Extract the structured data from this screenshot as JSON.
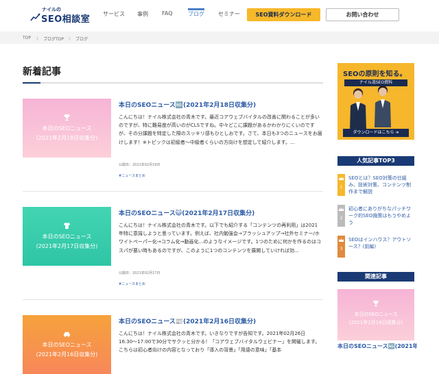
{
  "header": {
    "logo_small": "ナイルの",
    "logo_main": "SEO相談室",
    "nav": [
      {
        "label": "サービス"
      },
      {
        "label": "事例"
      },
      {
        "label": "FAQ"
      },
      {
        "label": "ブログ"
      },
      {
        "label": "セミナー"
      }
    ],
    "download_label": "SEO資料ダウンロード",
    "contact_label": "お問い合わせ"
  },
  "breadcrumb": [
    "TOP",
    "ブログTOP",
    "ブログ"
  ],
  "breadcrumb_sep": "〉",
  "main": {
    "section_title": "新着記事",
    "articles": [
      {
        "thumb_lines": [
          "本日のSEOニュース",
          "(2021年2月18日収集分)"
        ],
        "title": "本日のSEOニュース🆖(2021年2月18日収集分)",
        "body": "こんにちは！ナイル株式会社の青木です。最近コアウェブバイタルの改善に関わることが多いのですが、特に難易度が高いのがCLSですね。中々どこに課題があるかわかりにくいのですが、その分課題を特定した際のスッキリ感もひとしおです。さて、本日も3つのニュースをお届けします！※トピックは初級者〜中級者くらいの方向けを想定して紹介します。...",
        "date": "公開日：2021年02月19日",
        "tag": "#ニュースまとめ"
      },
      {
        "thumb_lines": [
          "本日のSEOニュース",
          "(2021年2月17日収集分)"
        ],
        "title": "本日のSEOニュース😺(2021年2月17日収集分)",
        "body": "こんにちは！ナイル株式会社の青木です。以下でも紹介する「コンテンツの再利用」は2021年特に意識しようと思っています。例えば、社内勉強会→ブラッシュアップ→社外セミナー/ホワイトペーパー化→コラム化→動画化…のようなイメージです。1つのために何かを作るのはコスパが悪い時もあるのですが、このように1つのコンテンツを展開していければ効...",
        "date": "公開日：2021年02月17日",
        "tag": "#ニュースまとめ"
      },
      {
        "thumb_lines": [
          "本日のSEOニュース",
          "(2021年2月16日収集分)"
        ],
        "title": "本日のSEOニュース📰(2021年2月16日収集分)",
        "body": "こんにちは！ナイル株式会社の青木です。いきなりですが告知です。2021年02月26日16:30〜17:00で30分でサクッと分かる！「コアウェブバイタルウェビナー」を開催します。こちらは初心者向けの内容となっており「導入の背景」「用語の意味」「基本",
        "date": "",
        "tag": ""
      }
    ]
  },
  "sidebar": {
    "ad_title": "SEOの原則を知る。",
    "ad_sub": "ナイル流SEO資料",
    "ad_button": "ダウンロードはこちら ➔",
    "ranking_title": "人気記事TOP3",
    "ranking": [
      {
        "num": "1",
        "text": "SEOとは？SEO対策の仕組み、技術対策、コンテンツ制作まで解説"
      },
      {
        "num": "2",
        "text": "初心者にありがちなパッチワーク的SEO施策はもうやめよう"
      },
      {
        "num": "3",
        "text": "SEOはインハウス？アウトソース？(前編)"
      }
    ],
    "related_title": "関連記事",
    "related_thumb_lines": [
      "本日のSEOニュース",
      "(2021年2月18日収集分)"
    ],
    "related_article_title": "本日のSEOニュース🆖(2021年"
  },
  "colors": {
    "brand": "#1a3a75",
    "link": "#2b5aa5",
    "accent": "#f7b82a",
    "rank1": "#f6b72c",
    "rank2": "#bbbbbb",
    "rank3": "#e08a3c"
  }
}
